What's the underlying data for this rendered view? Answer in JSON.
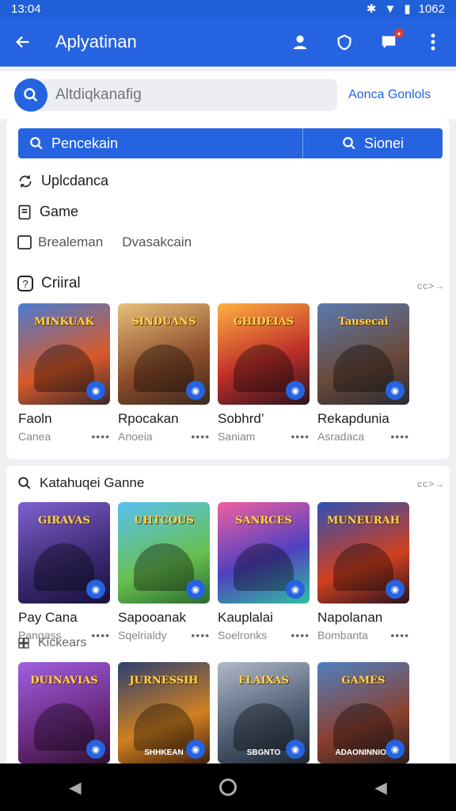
{
  "status": {
    "time": "13:04",
    "right": "1062"
  },
  "app": {
    "title": "Aplyatinan"
  },
  "search": {
    "placeholder": "Altdiqkanafig",
    "link": "Aonca Gonlols"
  },
  "segments": {
    "left": "Pencekain",
    "right": "Sionei"
  },
  "menu": [
    {
      "label": "Uplcdanca",
      "icon": "sync-icon"
    },
    {
      "label": "Game",
      "icon": "document-icon"
    }
  ],
  "filters": {
    "a": "Brealeman",
    "b": "Dvasakcain"
  },
  "sections": [
    {
      "title": "Criiral",
      "more": "cc>→",
      "items": [
        {
          "name": "Faoln",
          "sub": "Canea",
          "brand": "MINKUAK",
          "g": "g1"
        },
        {
          "name": "Rpocakan",
          "sub": "Anoeia",
          "brand": "SINDUANS",
          "g": "g2"
        },
        {
          "name": "Sobhrd’",
          "sub": "Saniam",
          "brand": "GHIDEIAS",
          "g": "g3"
        },
        {
          "name": "Rekapdunia",
          "sub": "Asradaca",
          "brand": "Tausecai",
          "g": "g4"
        }
      ]
    },
    {
      "title": "Katahuqei Ganne",
      "more": "cc>→",
      "items": [
        {
          "name": "Pay Cana",
          "sub": "Pangass",
          "brand": "GIRAVAS",
          "g": "g5"
        },
        {
          "name": "Sapooanak",
          "sub": "Sqelrialdy",
          "brand": "UHTCOUS",
          "g": "g6"
        },
        {
          "name": "Kauplalai",
          "sub": "Soelronks",
          "brand": "SANRCES",
          "g": "g7"
        },
        {
          "name": "Napolanan",
          "sub": "Bombanta",
          "brand": "MUNEURAH",
          "g": "g8"
        }
      ]
    },
    {
      "title": "Kickears",
      "items": [
        {
          "brand": "DUINAVIAS",
          "caption": "",
          "g": "g9"
        },
        {
          "brand": "JURNESSIH",
          "caption": "SHHKEAN",
          "g": "g10"
        },
        {
          "brand": "FLAIXAS",
          "caption": "SBGNTO",
          "g": "g11"
        },
        {
          "brand": "GAMES",
          "caption": "ADAONINNIOE",
          "g": "g12"
        }
      ]
    }
  ]
}
